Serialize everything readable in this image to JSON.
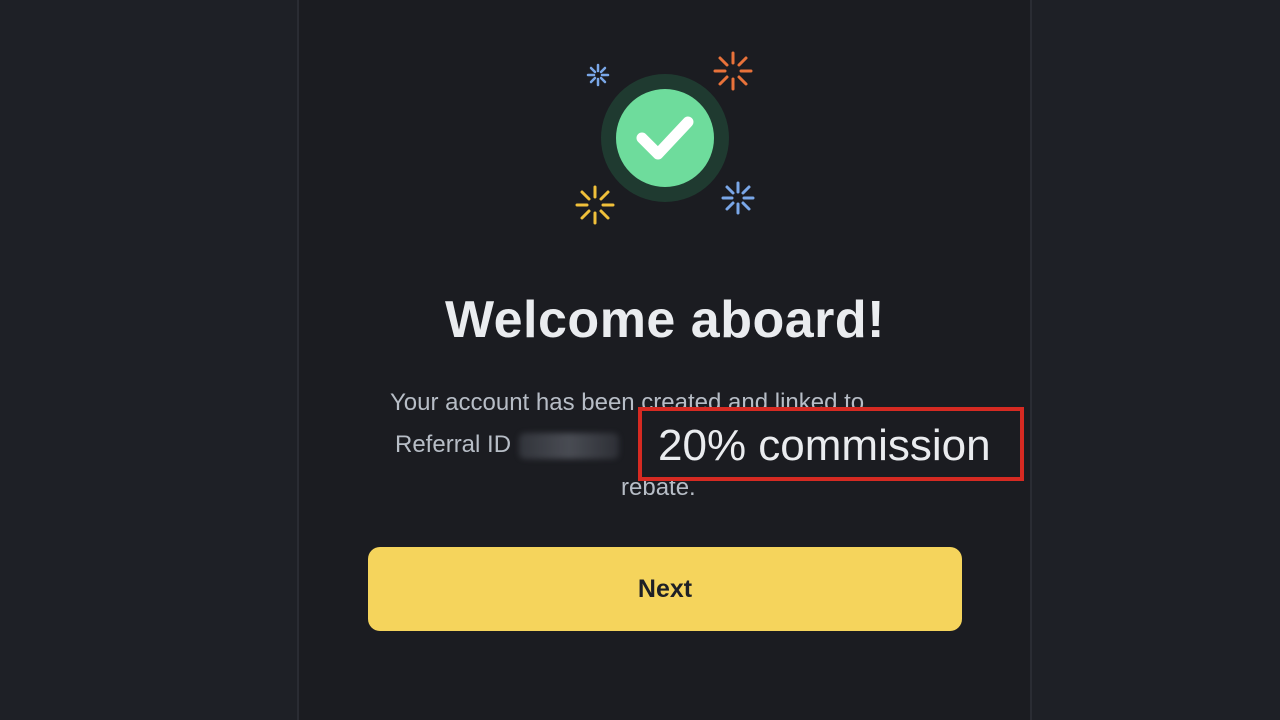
{
  "colors": {
    "background": "#1e2026",
    "panel": "#1b1c21",
    "success_green": "#6edc9c",
    "success_ring": "#1f3a30",
    "accent_yellow": "#f5d45c",
    "highlight_red": "#d62a22",
    "spark_blue": "#7aa7e8",
    "spark_orange": "#e8723a",
    "spark_yellow": "#f0c03a"
  },
  "icons": {
    "success": "check-circle-icon",
    "sparkles": "sparkle-icon"
  },
  "dialog": {
    "title": "Welcome aboard!",
    "description": {
      "line1": "Your account has been created and linked to",
      "line2_prefix": "Referral ID",
      "line3": "rebate."
    },
    "highlight_text": "20% commission",
    "next_label": "Next"
  }
}
